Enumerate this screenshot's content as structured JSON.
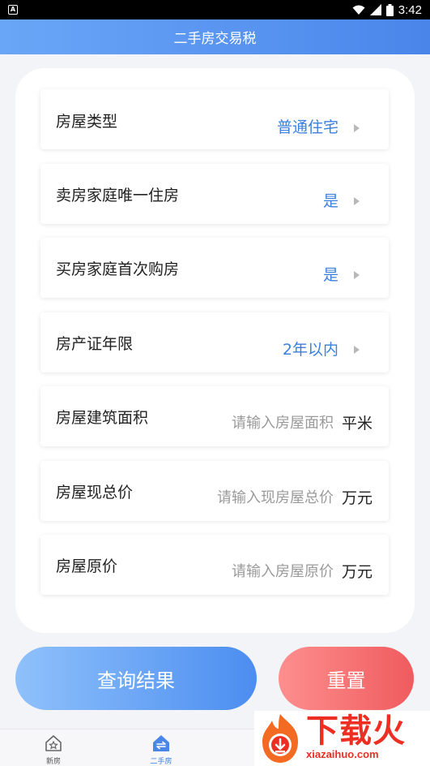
{
  "status_bar": {
    "time": "3:42"
  },
  "header": {
    "title": "二手房交易税"
  },
  "form": {
    "house_type": {
      "label": "房屋类型",
      "value": "普通住宅"
    },
    "seller_only_home": {
      "label": "卖房家庭唯一住房",
      "value": "是"
    },
    "buyer_first_home": {
      "label": "买房家庭首次购房",
      "value": "是"
    },
    "cert_years": {
      "label": "房产证年限",
      "value": "2年以内"
    },
    "area": {
      "label": "房屋建筑面积",
      "placeholder": "请输入房屋面积",
      "unit": "平米"
    },
    "current_price": {
      "label": "房屋现总价",
      "placeholder": "请输入现房屋总价",
      "unit": "万元"
    },
    "original_price": {
      "label": "房屋原价",
      "placeholder": "请输入房屋原价",
      "unit": "万元"
    }
  },
  "buttons": {
    "query": "查询结果",
    "reset": "重置"
  },
  "bottom_nav": {
    "items": [
      {
        "label": "新房",
        "icon": "new-house-icon"
      },
      {
        "label": "二手房",
        "icon": "second-hand-house-icon",
        "active": true
      }
    ]
  },
  "watermark": {
    "text": "下载火",
    "url": "xiazaihuo.com"
  },
  "colors": {
    "accent": "#3b7fe0",
    "header_start": "#6aa6f7",
    "header_end": "#4a86ea",
    "reset_end": "#f05b5e"
  }
}
